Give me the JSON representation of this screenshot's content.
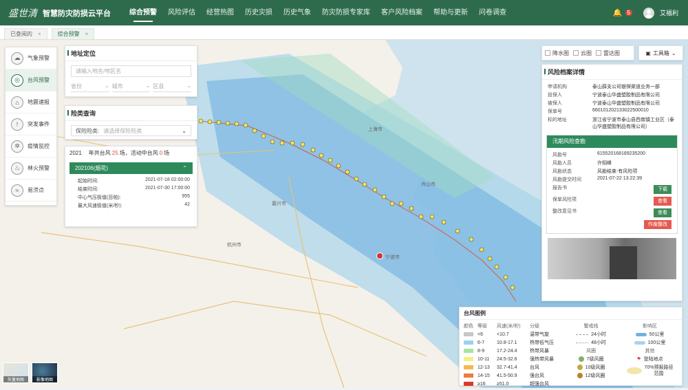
{
  "app": {
    "logo_script": "盛世清",
    "title": "智慧防灾防损云平台"
  },
  "nav": [
    "综合预警",
    "风险评估",
    "经营热图",
    "历史灾损",
    "历史气象",
    "防灾防损专家库",
    "客户风险档案",
    "帮助与更新",
    "问卷调查"
  ],
  "nav_active": 0,
  "header": {
    "notify_count": "5",
    "user": "艾福利"
  },
  "tabs": [
    {
      "label": "已查阅的"
    },
    {
      "label": "综合预警"
    }
  ],
  "sidebar": {
    "items": [
      {
        "label": "气象预警",
        "icon": "cloud-icon"
      },
      {
        "label": "台风预警",
        "icon": "typhoon-icon"
      },
      {
        "label": "地震速报",
        "icon": "earthquake-icon"
      },
      {
        "label": "突发事件",
        "icon": "alert-icon"
      },
      {
        "label": "疫情监控",
        "icon": "virus-icon"
      },
      {
        "label": "林火预警",
        "icon": "fire-icon"
      },
      {
        "label": "易涝点",
        "icon": "flood-icon"
      }
    ],
    "active": 1
  },
  "location": {
    "title": "地址定位",
    "placeholder": "请输入地名/地区名",
    "province": "省份",
    "city": "城市",
    "district": "区县"
  },
  "insurance": {
    "title": "险类查询",
    "label": "保险险类:",
    "placeholder": "请选择保险险类"
  },
  "typhoon": {
    "year": "2021",
    "summary_pre": "年共台风",
    "count": "25",
    "summary_mid": "场，活动中台风",
    "active": "0",
    "summary_post": "场",
    "selected": "202106(烟花)",
    "details": [
      {
        "k": "起始时间:",
        "v": "2021-07-18 02:00:00"
      },
      {
        "k": "结束时间:",
        "v": "2021-07-30 17:00:00"
      },
      {
        "k": "中心气压极值(百帕):",
        "v": "955"
      },
      {
        "k": "最大风速极值(米/秒):",
        "v": "42"
      }
    ]
  },
  "layers": {
    "items": [
      "降水图",
      "云图",
      "雷达图"
    ],
    "toolbox": "工具箱"
  },
  "risk": {
    "title": "风险档案详情",
    "fields": [
      {
        "k": "申请机构",
        "v": "泰山薛支公司银保渠道业务一部"
      },
      {
        "k": "投保人",
        "v": "宁波泰山华盛塑胶制品有限公司"
      },
      {
        "k": "被保人",
        "v": "宁波泰山华盛塑胶制品有限公司"
      },
      {
        "k": "保单号",
        "v": "660101202133022500010"
      },
      {
        "k": "标的地址",
        "v": "浙江省宁波市泰山县西南镇工业区（泰山华盛塑胶制品有限公司）"
      }
    ],
    "flood_title": "汛期风险查勘",
    "flood": [
      {
        "k": "风勘号",
        "v": "615520168189235200"
      },
      {
        "k": "风勘人员",
        "v": "许栩峰"
      },
      {
        "k": "风勘状态",
        "v": "风勘结束-有风险项"
      },
      {
        "k": "风勘提交时间",
        "v": "2021-07-22 13:22:39"
      },
      {
        "k": "报告书",
        "v": ""
      },
      {
        "k": "保单风险项",
        "v": ""
      },
      {
        "k": "整改意见书",
        "v": ""
      }
    ],
    "buttons": {
      "download": "下载",
      "view1": "查看",
      "view2": "查看",
      "rectify": "作废整改"
    },
    "colors": {
      "download": "#3d8c5a",
      "view1": "#e45a4f",
      "view2": "#3d8c5a",
      "rectify": "#e45a4f"
    }
  },
  "legend": {
    "title": "台风图例",
    "headers": {
      "color": "颜色",
      "level": "等级",
      "speed": "风速(米/秒)",
      "grade": "分级",
      "track": "警戒线",
      "wind": "风圈",
      "zone": "影响区",
      "other": "其他"
    },
    "rows": [
      {
        "color": "#c7c7c7",
        "level": "<6",
        "speed": "<10.7",
        "grade": "温带气旋"
      },
      {
        "color": "#9ad1f0",
        "level": "6-7",
        "speed": "10.8-17.1",
        "grade": "热带低气压"
      },
      {
        "color": "#a7e4a0",
        "level": "8-9",
        "speed": "17.2-24.4",
        "grade": "热带风暴"
      },
      {
        "color": "#f7ef7e",
        "level": "10-11",
        "speed": "24.5-32.6",
        "grade": "强热带风暴"
      },
      {
        "color": "#f5b74d",
        "level": "12-13",
        "speed": "32.7-41.4",
        "grade": "台风"
      },
      {
        "color": "#ef7b3d",
        "level": "14-15",
        "speed": "41.5-50.9",
        "grade": "强台风"
      },
      {
        "color": "#d93a2b",
        "level": "≥16",
        "speed": "≥51.0",
        "grade": "超强台风"
      }
    ],
    "track": [
      "24小时",
      "48小时"
    ],
    "wind": [
      "7级风圈",
      "10级风圈",
      "12级风圈"
    ],
    "zone": [
      "50公里",
      "100公里"
    ],
    "other": [
      "登陆地点",
      "70%预报路径范围"
    ]
  },
  "thumbs": [
    "矢量地图",
    "影像地图"
  ],
  "map_places": [
    "上海市",
    "嘉兴市",
    "宁波市",
    "杭州市",
    "舟山市"
  ]
}
